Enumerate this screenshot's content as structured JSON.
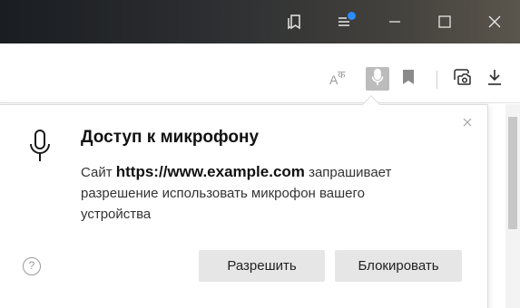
{
  "titlebar": {
    "buttons": [
      "collections-icon",
      "menu-icon",
      "minimize-icon",
      "maximize-icon",
      "close-icon"
    ],
    "notification_color": "#2a8cff"
  },
  "toolbar": {
    "icons": [
      "translate-icon",
      "microphone-icon",
      "bookmark-icon",
      "screenshot-icon",
      "download-icon"
    ],
    "active": "microphone-icon"
  },
  "popup": {
    "title": "Доступ к микрофону",
    "body_prefix": "Сайт",
    "site_url": "https://www.example.com",
    "body_suffix": "запрашивает разрешение использовать микрофон вашего устройства",
    "help_label": "?",
    "allow_button": "Разрешить",
    "block_button": "Блокировать"
  }
}
